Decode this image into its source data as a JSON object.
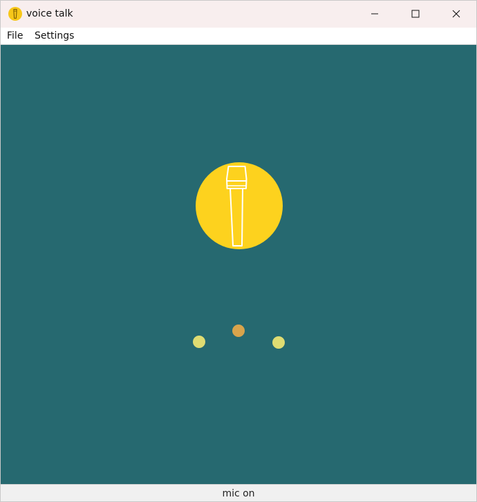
{
  "window": {
    "title": "voice talk",
    "icon": "microphone-icon"
  },
  "title_buttons": {
    "minimize_icon": "minimize-icon",
    "maximize_icon": "maximize-icon",
    "close_icon": "close-icon"
  },
  "menu": {
    "items": [
      {
        "label": "File"
      },
      {
        "label": "Settings"
      }
    ]
  },
  "stage": {
    "background": "#266970",
    "mic_button": {
      "icon": "microphone-icon",
      "color": "#fdd21e"
    },
    "indicator_dots": [
      {
        "color": "#dfdc72"
      },
      {
        "color": "#d9a44c"
      },
      {
        "color": "#dfdc72"
      }
    ]
  },
  "status": {
    "text": "mic on"
  }
}
